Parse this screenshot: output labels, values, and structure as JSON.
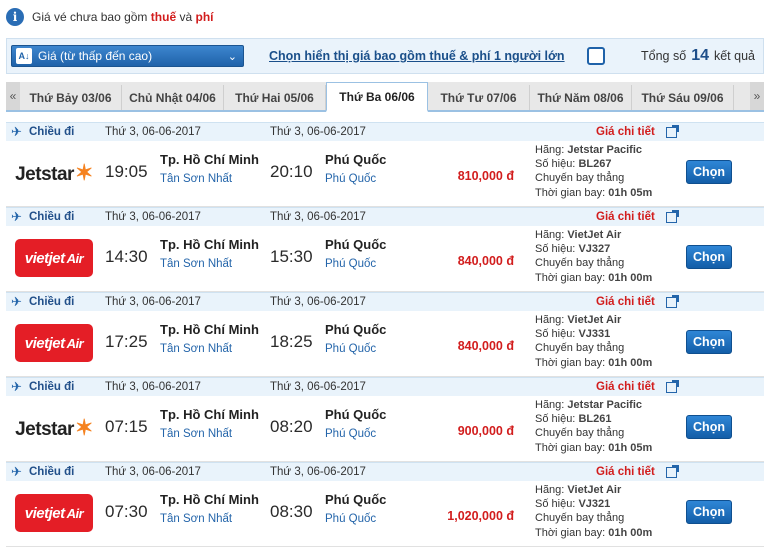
{
  "notice": {
    "prefix": "Giá vé chưa bao gồm",
    "tax": "thuế",
    "and": "và",
    "fee": "phí"
  },
  "controls": {
    "sort_label": "Giá (từ thấp đến cao)",
    "tax_toggle_label": "Chọn hiển thị giá bao gồm thuế & phí 1 người lớn",
    "total_prefix": "Tổng số",
    "total_count": "14",
    "total_suffix": "kết quả"
  },
  "tabs": [
    {
      "label": "Thứ Bảy 03/06"
    },
    {
      "label": "Chủ Nhật 04/06"
    },
    {
      "label": "Thứ Hai 05/06"
    },
    {
      "label": "Thứ Ba 06/06"
    },
    {
      "label": "Thứ Tư 07/06"
    },
    {
      "label": "Thứ Năm 08/06"
    },
    {
      "label": "Thứ Sáu 09/06"
    }
  ],
  "active_tab": 3,
  "flights": [
    {
      "direction": "Chiều đi",
      "dep_date": "Thứ 3, 06-06-2017",
      "arr_date": "Thứ 3, 06-06-2017",
      "detail_label": "Giá chi tiết",
      "airline_logo": "Jetstar",
      "dep_time": "19:05",
      "dep_city": "Tp. Hồ Chí Minh",
      "dep_airport": "Tân Sơn Nhất",
      "arr_time": "20:10",
      "arr_city": "Phú Quốc",
      "arr_airport": "Phú Quốc",
      "price": "810,000 đ",
      "airline_label": "Hãng:",
      "airline": "Jetstar Pacific",
      "flight_no_label": "Số hiệu:",
      "flight_no": "BL267",
      "flight_type": "Chuyến bay thẳng",
      "duration_label": "Thời gian bay:",
      "duration": "01h 05m",
      "button": "Chọn"
    },
    {
      "direction": "Chiều đi",
      "dep_date": "Thứ 3, 06-06-2017",
      "arr_date": "Thứ 3, 06-06-2017",
      "detail_label": "Giá chi tiết",
      "airline_logo": "VietJet",
      "dep_time": "14:30",
      "dep_city": "Tp. Hồ Chí Minh",
      "dep_airport": "Tân Sơn Nhất",
      "arr_time": "15:30",
      "arr_city": "Phú Quốc",
      "arr_airport": "Phú Quốc",
      "price": "840,000 đ",
      "airline_label": "Hãng:",
      "airline": "VietJet Air",
      "flight_no_label": "Số hiệu:",
      "flight_no": "VJ327",
      "flight_type": "Chuyến bay thẳng",
      "duration_label": "Thời gian bay:",
      "duration": "01h 00m",
      "button": "Chọn"
    },
    {
      "direction": "Chiều đi",
      "dep_date": "Thứ 3, 06-06-2017",
      "arr_date": "Thứ 3, 06-06-2017",
      "detail_label": "Giá chi tiết",
      "airline_logo": "VietJet",
      "dep_time": "17:25",
      "dep_city": "Tp. Hồ Chí Minh",
      "dep_airport": "Tân Sơn Nhất",
      "arr_time": "18:25",
      "arr_city": "Phú Quốc",
      "arr_airport": "Phú Quốc",
      "price": "840,000 đ",
      "airline_label": "Hãng:",
      "airline": "VietJet Air",
      "flight_no_label": "Số hiệu:",
      "flight_no": "VJ331",
      "flight_type": "Chuyến bay thẳng",
      "duration_label": "Thời gian bay:",
      "duration": "01h 00m",
      "button": "Chọn"
    },
    {
      "direction": "Chiều đi",
      "dep_date": "Thứ 3, 06-06-2017",
      "arr_date": "Thứ 3, 06-06-2017",
      "detail_label": "Giá chi tiết",
      "airline_logo": "Jetstar",
      "dep_time": "07:15",
      "dep_city": "Tp. Hồ Chí Minh",
      "dep_airport": "Tân Sơn Nhất",
      "arr_time": "08:20",
      "arr_city": "Phú Quốc",
      "arr_airport": "Phú Quốc",
      "price": "900,000 đ",
      "airline_label": "Hãng:",
      "airline": "Jetstar Pacific",
      "flight_no_label": "Số hiệu:",
      "flight_no": "BL261",
      "flight_type": "Chuyến bay thẳng",
      "duration_label": "Thời gian bay:",
      "duration": "01h 05m",
      "button": "Chọn"
    },
    {
      "direction": "Chiều đi",
      "dep_date": "Thứ 3, 06-06-2017",
      "arr_date": "Thứ 3, 06-06-2017",
      "detail_label": "Giá chi tiết",
      "airline_logo": "VietJet",
      "dep_time": "07:30",
      "dep_city": "Tp. Hồ Chí Minh",
      "dep_airport": "Tân Sơn Nhất",
      "arr_time": "08:30",
      "arr_city": "Phú Quốc",
      "arr_airport": "Phú Quốc",
      "price": "1,020,000 đ",
      "airline_label": "Hãng:",
      "airline": "VietJet Air",
      "flight_no_label": "Số hiệu:",
      "flight_no": "VJ321",
      "flight_type": "Chuyến bay thẳng",
      "duration_label": "Thời gian bay:",
      "duration": "01h 00m",
      "button": "Chọn"
    }
  ]
}
